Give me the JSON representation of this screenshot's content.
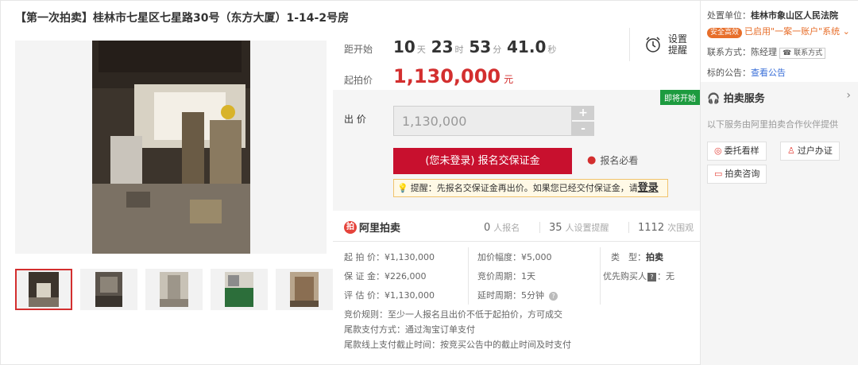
{
  "title": "【第一次拍卖】桂林市七星区七星路30号（东方大厦）1-14-2号房",
  "countdown": {
    "label": "距开始",
    "days": "10",
    "days_unit": "天",
    "hours": "23",
    "hours_unit": "时",
    "minutes": "53",
    "minutes_unit": "分",
    "seconds": "41.0",
    "seconds_unit": "秒",
    "reminder_label": "设置提醒",
    "reminder_icon": "alarm-clock-icon"
  },
  "start_price": {
    "label": "起拍价",
    "value": "1,130,000",
    "unit": "元"
  },
  "bid": {
    "status_badge": "即将开始",
    "label": "出 价",
    "input_value": "1,130,000",
    "plus": "+",
    "minus": "-",
    "signup_button": "(您未登录) 报名交保证金",
    "must_see": "报名必看",
    "tip_prefix": "提醒：先报名交保证金再出价。如果您已经交付保证金，请",
    "tip_login": "登录"
  },
  "stats": {
    "brand": "阿里拍卖",
    "signups": "0",
    "signups_label": "人报名",
    "reminders": "35",
    "reminders_label": "人设置提醒",
    "views": "1112",
    "views_label": "次围观"
  },
  "details": {
    "start_price_label": "起 拍 价：",
    "start_price_value": "¥1,130,000",
    "increment_label": "加价幅度：",
    "increment_value": "¥5,000",
    "type_label": "类　型：",
    "type_value": "拍卖",
    "deposit_label": "保 证 金：",
    "deposit_value": "¥226,000",
    "cycle_label": "竞价周期：",
    "cycle_value": "1天",
    "priority_label": "优先购买人",
    "priority_value": "：无",
    "estimate_label": "评 估 价：",
    "estimate_value": "¥1,130,000",
    "delay_label": "延时周期：",
    "delay_value": "5分钟",
    "rule_label": "竞价规则：",
    "rule_value": "至少一人报名且出价不低于起拍价，方可成交",
    "pay_label": "尾款支付方式：",
    "pay_value": "通过淘宝订单支付",
    "deadline_label": "尾款线上支付截止时间：",
    "deadline_value": "按竞买公告中的截止时间及时支付"
  },
  "sidebar": {
    "org_label": "处置单位：",
    "org_value": "桂林市象山区人民法院",
    "safe_badge": "安全高效",
    "safe_text": "已启用\"一案一账户\"系统",
    "contact_label": "联系方式：",
    "contact_value": "陈经理",
    "contact_tag": "联系方式",
    "notice_label": "标的公告：",
    "notice_link": "查看公告",
    "service_title": "拍卖服务",
    "service_sub": "以下服务由阿里拍卖合作伙伴提供",
    "services": [
      "委托看样",
      "过户办证",
      "拍卖咨询"
    ]
  },
  "colors": {
    "accent_red": "#c8102e",
    "price_red": "#d32f2f",
    "badge_green": "#1d9b3f",
    "safe_orange": "#e76e2a",
    "link_blue": "#3a6fd8"
  }
}
